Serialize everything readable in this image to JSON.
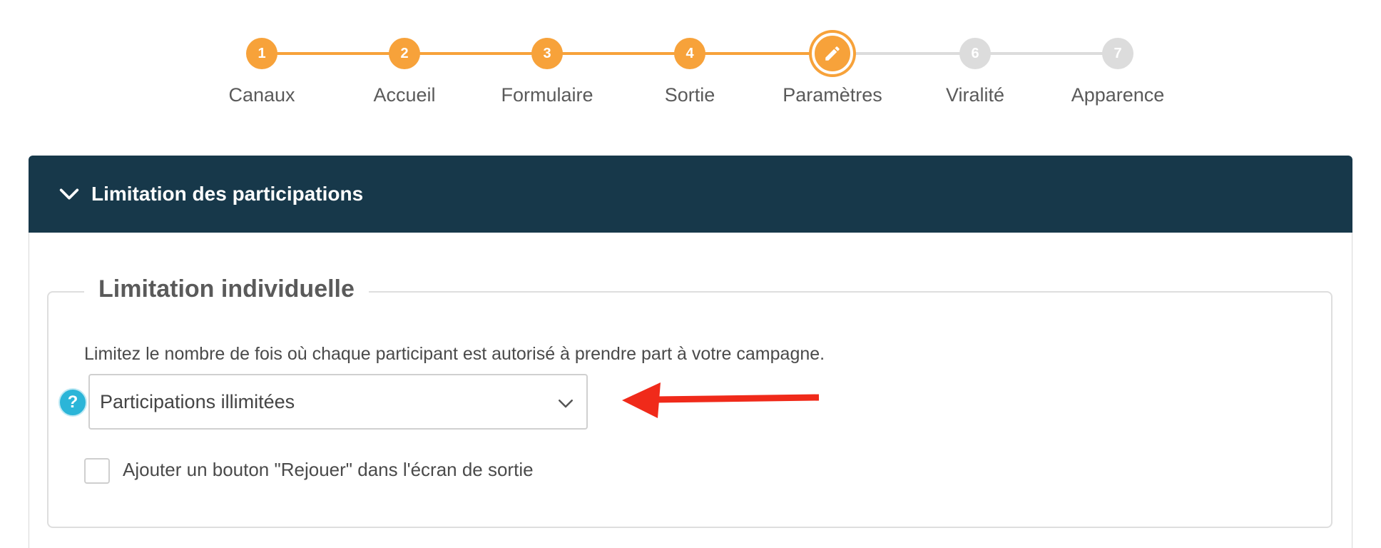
{
  "stepper": {
    "steps": [
      {
        "number": "1",
        "label": "Canaux",
        "state": "done"
      },
      {
        "number": "2",
        "label": "Accueil",
        "state": "done"
      },
      {
        "number": "3",
        "label": "Formulaire",
        "state": "done"
      },
      {
        "number": "4",
        "label": "Sortie",
        "state": "done"
      },
      {
        "number": "",
        "label": "Paramètres",
        "state": "active",
        "icon": "pencil-icon"
      },
      {
        "number": "6",
        "label": "Viralité",
        "state": "todo"
      },
      {
        "number": "7",
        "label": "Apparence",
        "state": "todo"
      }
    ]
  },
  "panel": {
    "title": "Limitation des participations",
    "toggle_icon": "chevron-down-icon"
  },
  "section": {
    "legend": "Limitation individuelle",
    "description": "Limitez le nombre de fois où chaque participant est autorisé à prendre part à votre campagne.",
    "help_icon": "?",
    "select_value": "Participations illimitées",
    "checkbox_label": "Ajouter un bouton \"Rejouer\" dans l'écran de sortie",
    "checkbox_checked": false
  },
  "colors": {
    "accent": "#f7a23a",
    "header_bg": "#17384a",
    "inactive": "#dcdcdc",
    "help": "#2bb5d8",
    "annotation_arrow": "#f02a1a"
  }
}
